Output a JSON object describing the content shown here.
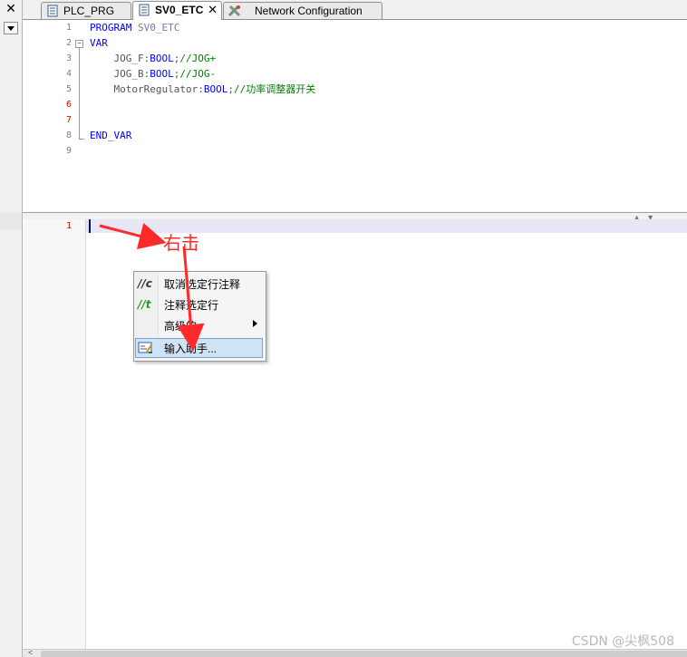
{
  "tabs": [
    {
      "label": "PLC_PRG",
      "active": false,
      "icon": "document-icon"
    },
    {
      "label": "SV0_ETC",
      "active": true,
      "icon": "document-icon",
      "close": "✕"
    },
    {
      "label": "Network Configuration",
      "active": false,
      "icon": "network-config-icon"
    }
  ],
  "left_strip": {
    "close": "✕"
  },
  "declaration": {
    "line_numbers": [
      "1",
      "2",
      "3",
      "4",
      "5",
      "6",
      "7",
      "8",
      "9"
    ],
    "fold_marker": "−",
    "lines": [
      [
        {
          "t": "PROGRAM ",
          "c": "kw"
        },
        {
          "t": "SV0_ETC",
          "c": "id"
        }
      ],
      [
        {
          "t": "VAR",
          "c": "kw"
        }
      ],
      [
        {
          "t": "    JOG_F:",
          "c": "tx"
        },
        {
          "t": "BOOL",
          "c": "kw"
        },
        {
          "t": ";",
          "c": "tx"
        },
        {
          "t": "//JOG+",
          "c": "cm"
        }
      ],
      [
        {
          "t": "    JOG_B:",
          "c": "tx"
        },
        {
          "t": "BOOL",
          "c": "kw"
        },
        {
          "t": ";",
          "c": "tx"
        },
        {
          "t": "//JOG-",
          "c": "cm"
        }
      ],
      [
        {
          "t": "    MotorRegulator:",
          "c": "tx"
        },
        {
          "t": "BOOL",
          "c": "kw"
        },
        {
          "t": ";",
          "c": "tx"
        },
        {
          "t": "//功率调整器开关",
          "c": "cm"
        }
      ],
      [],
      [],
      [
        {
          "t": "END_VAR",
          "c": "kw"
        }
      ],
      []
    ]
  },
  "implementation": {
    "line_number": "1"
  },
  "context_menu": {
    "items": [
      {
        "label": "取消选定行注释",
        "icon": "uncomment-icon",
        "icon_glyph": "//c",
        "hover": false,
        "submenu": false
      },
      {
        "label": "注释选定行",
        "icon": "comment-icon",
        "icon_glyph": "//t",
        "hover": false,
        "submenu": false
      },
      {
        "label": "高级的",
        "icon": "",
        "icon_glyph": "",
        "hover": false,
        "submenu": true
      },
      {
        "label": "输入助手...",
        "icon": "input-assistant-icon",
        "icon_glyph": "",
        "hover": true,
        "submenu": false
      }
    ]
  },
  "annotation": {
    "text": "右击",
    "color": "#ff2a2a"
  },
  "watermark": "CSDN @尖枫508",
  "colors": {
    "keyword": "#0000ff",
    "comment": "#008000",
    "line_number_error": "#e00000"
  }
}
